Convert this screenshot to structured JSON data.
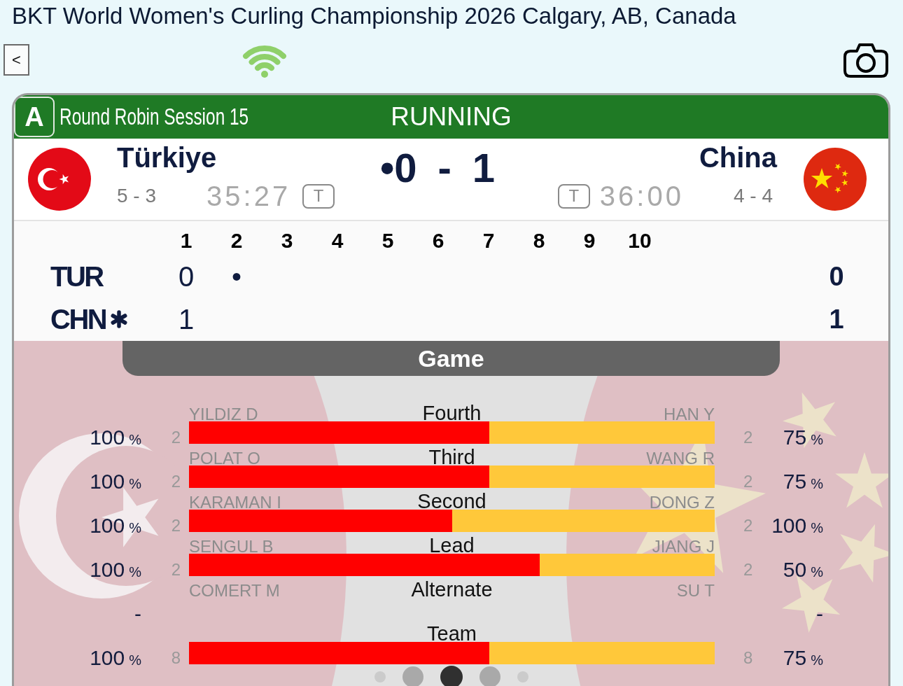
{
  "header": {
    "title": "BKT World Women's Curling Championship 2026 Calgary, AB, Canada",
    "back_button": "<"
  },
  "game": {
    "sheet": "A",
    "session": "Round Robin Session 15",
    "status": "RUNNING",
    "score": {
      "home": "•0",
      "separator": "-",
      "away": "1"
    }
  },
  "teams": [
    {
      "kind": "crescent",
      "name": "Türkiye",
      "record": "5 - 3",
      "clock": "35:27",
      "timeout_label": "T"
    },
    {
      "kind": "stars",
      "name": "China",
      "record": "4 - 4",
      "clock": "36:00",
      "timeout_label": "T"
    }
  ],
  "linescore": {
    "ends": [
      "1",
      "2",
      "3",
      "4",
      "5",
      "6",
      "7",
      "8",
      "9",
      "10"
    ],
    "rows": [
      {
        "team": "TUR",
        "hammer": false,
        "scores": [
          "0",
          "•"
        ],
        "total": "0"
      },
      {
        "team": "CHN",
        "hammer": true,
        "scores": [
          "1"
        ],
        "total": "1"
      }
    ]
  },
  "stats": {
    "tab": "Game",
    "rows": [
      {
        "kind": "bar",
        "position": "Fourth",
        "home_player": "YILDIZ D",
        "away_player": "HAN Y",
        "home_pct": "100",
        "home_unit": "%",
        "home_shots": "2",
        "away_shots": "2",
        "away_pct": "75",
        "away_unit": "%",
        "level": 0.571
      },
      {
        "kind": "bar",
        "position": "Third",
        "home_player": "POLAT O",
        "away_player": "WANG R",
        "home_pct": "100",
        "home_unit": "%",
        "home_shots": "2",
        "away_shots": "2",
        "away_pct": "75",
        "away_unit": "%",
        "level": 0.571
      },
      {
        "kind": "bar",
        "position": "Second",
        "home_player": "KARAMAN I",
        "away_player": "DONG Z",
        "home_pct": "100",
        "home_unit": "%",
        "home_shots": "2",
        "away_shots": "2",
        "away_pct": "100",
        "away_unit": "%",
        "level": 0.5
      },
      {
        "kind": "bar",
        "position": "Lead",
        "home_player": "SENGUL B",
        "away_player": "JIANG J",
        "home_pct": "100",
        "home_unit": "%",
        "home_shots": "2",
        "away_shots": "2",
        "away_pct": "50",
        "away_unit": "%",
        "level": 0.667
      },
      {
        "kind": "none",
        "position": "Alternate",
        "home_player": "COMERT M",
        "away_player": "SU T",
        "home_pct": "-",
        "away_pct": "-"
      },
      {
        "kind": "bar",
        "position": "Team",
        "home_pct": "100",
        "home_unit": "%",
        "home_shots": "8",
        "away_shots": "8",
        "away_pct": "75",
        "away_unit": "%",
        "level": 0.571
      }
    ]
  },
  "pager": [
    {
      "selected": false
    },
    {
      "selected": false
    },
    {
      "selected": true
    },
    {
      "selected": false
    },
    {
      "selected": false
    }
  ]
}
